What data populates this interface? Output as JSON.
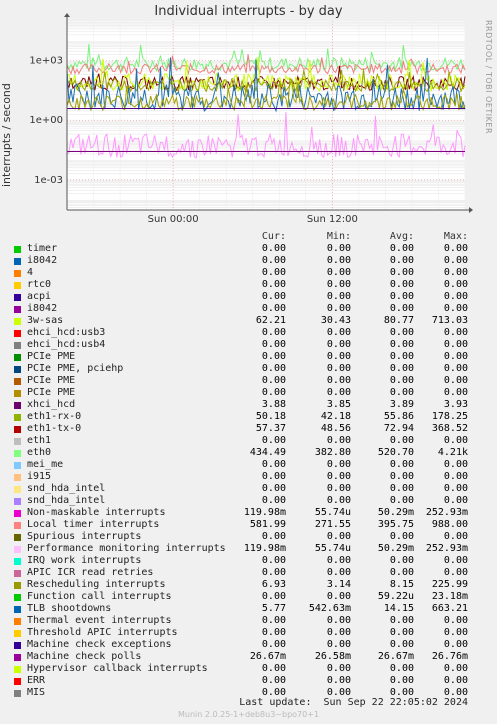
{
  "title": "Individual interrupts - by day",
  "side_label": "RRDTOOL / TOBI OETIKER",
  "ylabel": "interrupts / second",
  "footer": {
    "last_update": "Last update:  Sun Sep 22 22:05:02 2024",
    "munin": "Munin 2.0.25-1+deb8u3~bpo70+1"
  },
  "columns": {
    "cur": "Cur:",
    "min": "Min:",
    "avg": "Avg:",
    "max": "Max:"
  },
  "chart_data": {
    "type": "line",
    "yscale": "log",
    "ylim": [
      3e-05,
      100000
    ],
    "yticks": [
      {
        "value": 0.001,
        "label": "1e-03"
      },
      {
        "value": 1,
        "label": "1e+00"
      },
      {
        "value": 1000,
        "label": "1e+03"
      }
    ],
    "xticks": [
      {
        "hours": 8.0,
        "label": "Sun 00:00"
      },
      {
        "hours": 20.0,
        "label": "Sun 12:00"
      }
    ],
    "xrange_hours": 30,
    "series": [
      {
        "name": "eth0",
        "color": "#7CF27C",
        "level": 700,
        "noise": 0.35
      },
      {
        "name": "Local timer interrupts",
        "color": "#F08080",
        "level": 390,
        "noise": 0.25
      },
      {
        "name": "eth1-tx-0",
        "color": "#800000",
        "level": 73,
        "noise": 0.35
      },
      {
        "name": "3w-sas",
        "color": "#CCFF00",
        "level": 80,
        "noise": 0.45
      },
      {
        "name": "eth1-rx-0",
        "color": "#9BA300",
        "level": 56,
        "noise": 0.3
      },
      {
        "name": "TLB shootdowns",
        "color": "#1F6FAF",
        "level": 14,
        "noise": 0.7
      },
      {
        "name": "Rescheduling interrupts",
        "color": "#A0A000",
        "level": 8,
        "noise": 0.4
      },
      {
        "name": "xhci_hcd",
        "color": "#4A007F",
        "level": 3.9,
        "noise": 0.0
      },
      {
        "name": "Performance monitoring interrupts",
        "color": "#FF99FF",
        "level": 0.05,
        "noise": 0.6
      },
      {
        "name": "Machine check polls",
        "color": "#7F007F",
        "level": 0.0267,
        "noise": 0.0
      }
    ],
    "legend": [
      {
        "name": "timer",
        "color": "#00CC00",
        "cur": "0.00",
        "min": "0.00",
        "avg": "0.00",
        "max": "0.00"
      },
      {
        "name": "i8042",
        "color": "#0066B3",
        "cur": "0.00",
        "min": "0.00",
        "avg": "0.00",
        "max": "0.00"
      },
      {
        "name": "4",
        "color": "#FF8000",
        "cur": "0.00",
        "min": "0.00",
        "avg": "0.00",
        "max": "0.00"
      },
      {
        "name": "rtc0",
        "color": "#FFCC00",
        "cur": "0.00",
        "min": "0.00",
        "avg": "0.00",
        "max": "0.00"
      },
      {
        "name": "acpi",
        "color": "#330099",
        "cur": "0.00",
        "min": "0.00",
        "avg": "0.00",
        "max": "0.00"
      },
      {
        "name": "i8042",
        "color": "#990099",
        "cur": "0.00",
        "min": "0.00",
        "avg": "0.00",
        "max": "0.00"
      },
      {
        "name": "3w-sas",
        "color": "#CCFF00",
        "cur": "62.21",
        "min": "30.43",
        "avg": "80.77",
        "max": "713.03"
      },
      {
        "name": "ehci_hcd:usb3",
        "color": "#FF0000",
        "cur": "0.00",
        "min": "0.00",
        "avg": "0.00",
        "max": "0.00"
      },
      {
        "name": "ehci_hcd:usb4",
        "color": "#808080",
        "cur": "0.00",
        "min": "0.00",
        "avg": "0.00",
        "max": "0.00"
      },
      {
        "name": "PCIe PME",
        "color": "#008F00",
        "cur": "0.00",
        "min": "0.00",
        "avg": "0.00",
        "max": "0.00"
      },
      {
        "name": "PCIe PME, pciehp",
        "color": "#00487D",
        "cur": "0.00",
        "min": "0.00",
        "avg": "0.00",
        "max": "0.00"
      },
      {
        "name": "PCIe PME",
        "color": "#B35A00",
        "cur": "0.00",
        "min": "0.00",
        "avg": "0.00",
        "max": "0.00"
      },
      {
        "name": "PCIe PME",
        "color": "#B38F00",
        "cur": "0.00",
        "min": "0.00",
        "avg": "0.00",
        "max": "0.00"
      },
      {
        "name": "xhci_hcd",
        "color": "#6B006B",
        "cur": "3.88",
        "min": "3.85",
        "avg": "3.89",
        "max": "3.93"
      },
      {
        "name": "eth1-rx-0",
        "color": "#8FB300",
        "cur": "50.18",
        "min": "42.18",
        "avg": "55.86",
        "max": "178.25"
      },
      {
        "name": "eth1-tx-0",
        "color": "#B30000",
        "cur": "57.37",
        "min": "48.56",
        "avg": "72.94",
        "max": "368.52"
      },
      {
        "name": "eth1",
        "color": "#BEBEBE",
        "cur": "0.00",
        "min": "0.00",
        "avg": "0.00",
        "max": "0.00"
      },
      {
        "name": "eth0",
        "color": "#80FF80",
        "cur": "434.49",
        "min": "382.80",
        "avg": "520.70",
        "max": "4.21k"
      },
      {
        "name": "mei_me",
        "color": "#80C9FF",
        "cur": "0.00",
        "min": "0.00",
        "avg": "0.00",
        "max": "0.00"
      },
      {
        "name": "i915",
        "color": "#FFC080",
        "cur": "0.00",
        "min": "0.00",
        "avg": "0.00",
        "max": "0.00"
      },
      {
        "name": "snd_hda_intel",
        "color": "#FFE680",
        "cur": "0.00",
        "min": "0.00",
        "avg": "0.00",
        "max": "0.00"
      },
      {
        "name": "snd_hda_intel",
        "color": "#AA80FF",
        "cur": "0.00",
        "min": "0.00",
        "avg": "0.00",
        "max": "0.00"
      },
      {
        "name": "Non-maskable interrupts",
        "color": "#EE00CC",
        "cur": "119.98m",
        "min": "55.74u",
        "avg": "50.29m",
        "max": "252.93m"
      },
      {
        "name": "Local timer interrupts",
        "color": "#FF8080",
        "cur": "581.99",
        "min": "271.55",
        "avg": "395.75",
        "max": "988.00"
      },
      {
        "name": "Spurious interrupts",
        "color": "#666600",
        "cur": "0.00",
        "min": "0.00",
        "avg": "0.00",
        "max": "0.00"
      },
      {
        "name": "Performance monitoring interrupts",
        "color": "#FFBFFF",
        "cur": "119.98m",
        "min": "55.74u",
        "avg": "50.29m",
        "max": "252.93m"
      },
      {
        "name": "IRQ work interrupts",
        "color": "#00FFCC",
        "cur": "0.00",
        "min": "0.00",
        "avg": "0.00",
        "max": "0.00"
      },
      {
        "name": "APIC ICR read retries",
        "color": "#CC6699",
        "cur": "0.00",
        "min": "0.00",
        "avg": "0.00",
        "max": "0.00"
      },
      {
        "name": "Rescheduling interrupts",
        "color": "#999900",
        "cur": "6.93",
        "min": "3.14",
        "avg": "8.15",
        "max": "225.99"
      },
      {
        "name": "Function call interrupts",
        "color": "#00CC00",
        "cur": "0.00",
        "min": "0.00",
        "avg": "59.22u",
        "max": "23.18m"
      },
      {
        "name": "TLB shootdowns",
        "color": "#0066B3",
        "cur": "5.77",
        "min": "542.63m",
        "avg": "14.15",
        "max": "663.21"
      },
      {
        "name": "Thermal event interrupts",
        "color": "#FF8000",
        "cur": "0.00",
        "min": "0.00",
        "avg": "0.00",
        "max": "0.00"
      },
      {
        "name": "Threshold APIC interrupts",
        "color": "#FFCC00",
        "cur": "0.00",
        "min": "0.00",
        "avg": "0.00",
        "max": "0.00"
      },
      {
        "name": "Machine check exceptions",
        "color": "#330099",
        "cur": "0.00",
        "min": "0.00",
        "avg": "0.00",
        "max": "0.00"
      },
      {
        "name": "Machine check polls",
        "color": "#990099",
        "cur": "26.67m",
        "min": "26.58m",
        "avg": "26.67m",
        "max": "26.76m"
      },
      {
        "name": "Hypervisor callback interrupts",
        "color": "#CCFF00",
        "cur": "0.00",
        "min": "0.00",
        "avg": "0.00",
        "max": "0.00"
      },
      {
        "name": "ERR",
        "color": "#FF0000",
        "cur": "0.00",
        "min": "0.00",
        "avg": "0.00",
        "max": "0.00"
      },
      {
        "name": "MIS",
        "color": "#808080",
        "cur": "0.00",
        "min": "0.00",
        "avg": "0.00",
        "max": "0.00"
      }
    ]
  }
}
